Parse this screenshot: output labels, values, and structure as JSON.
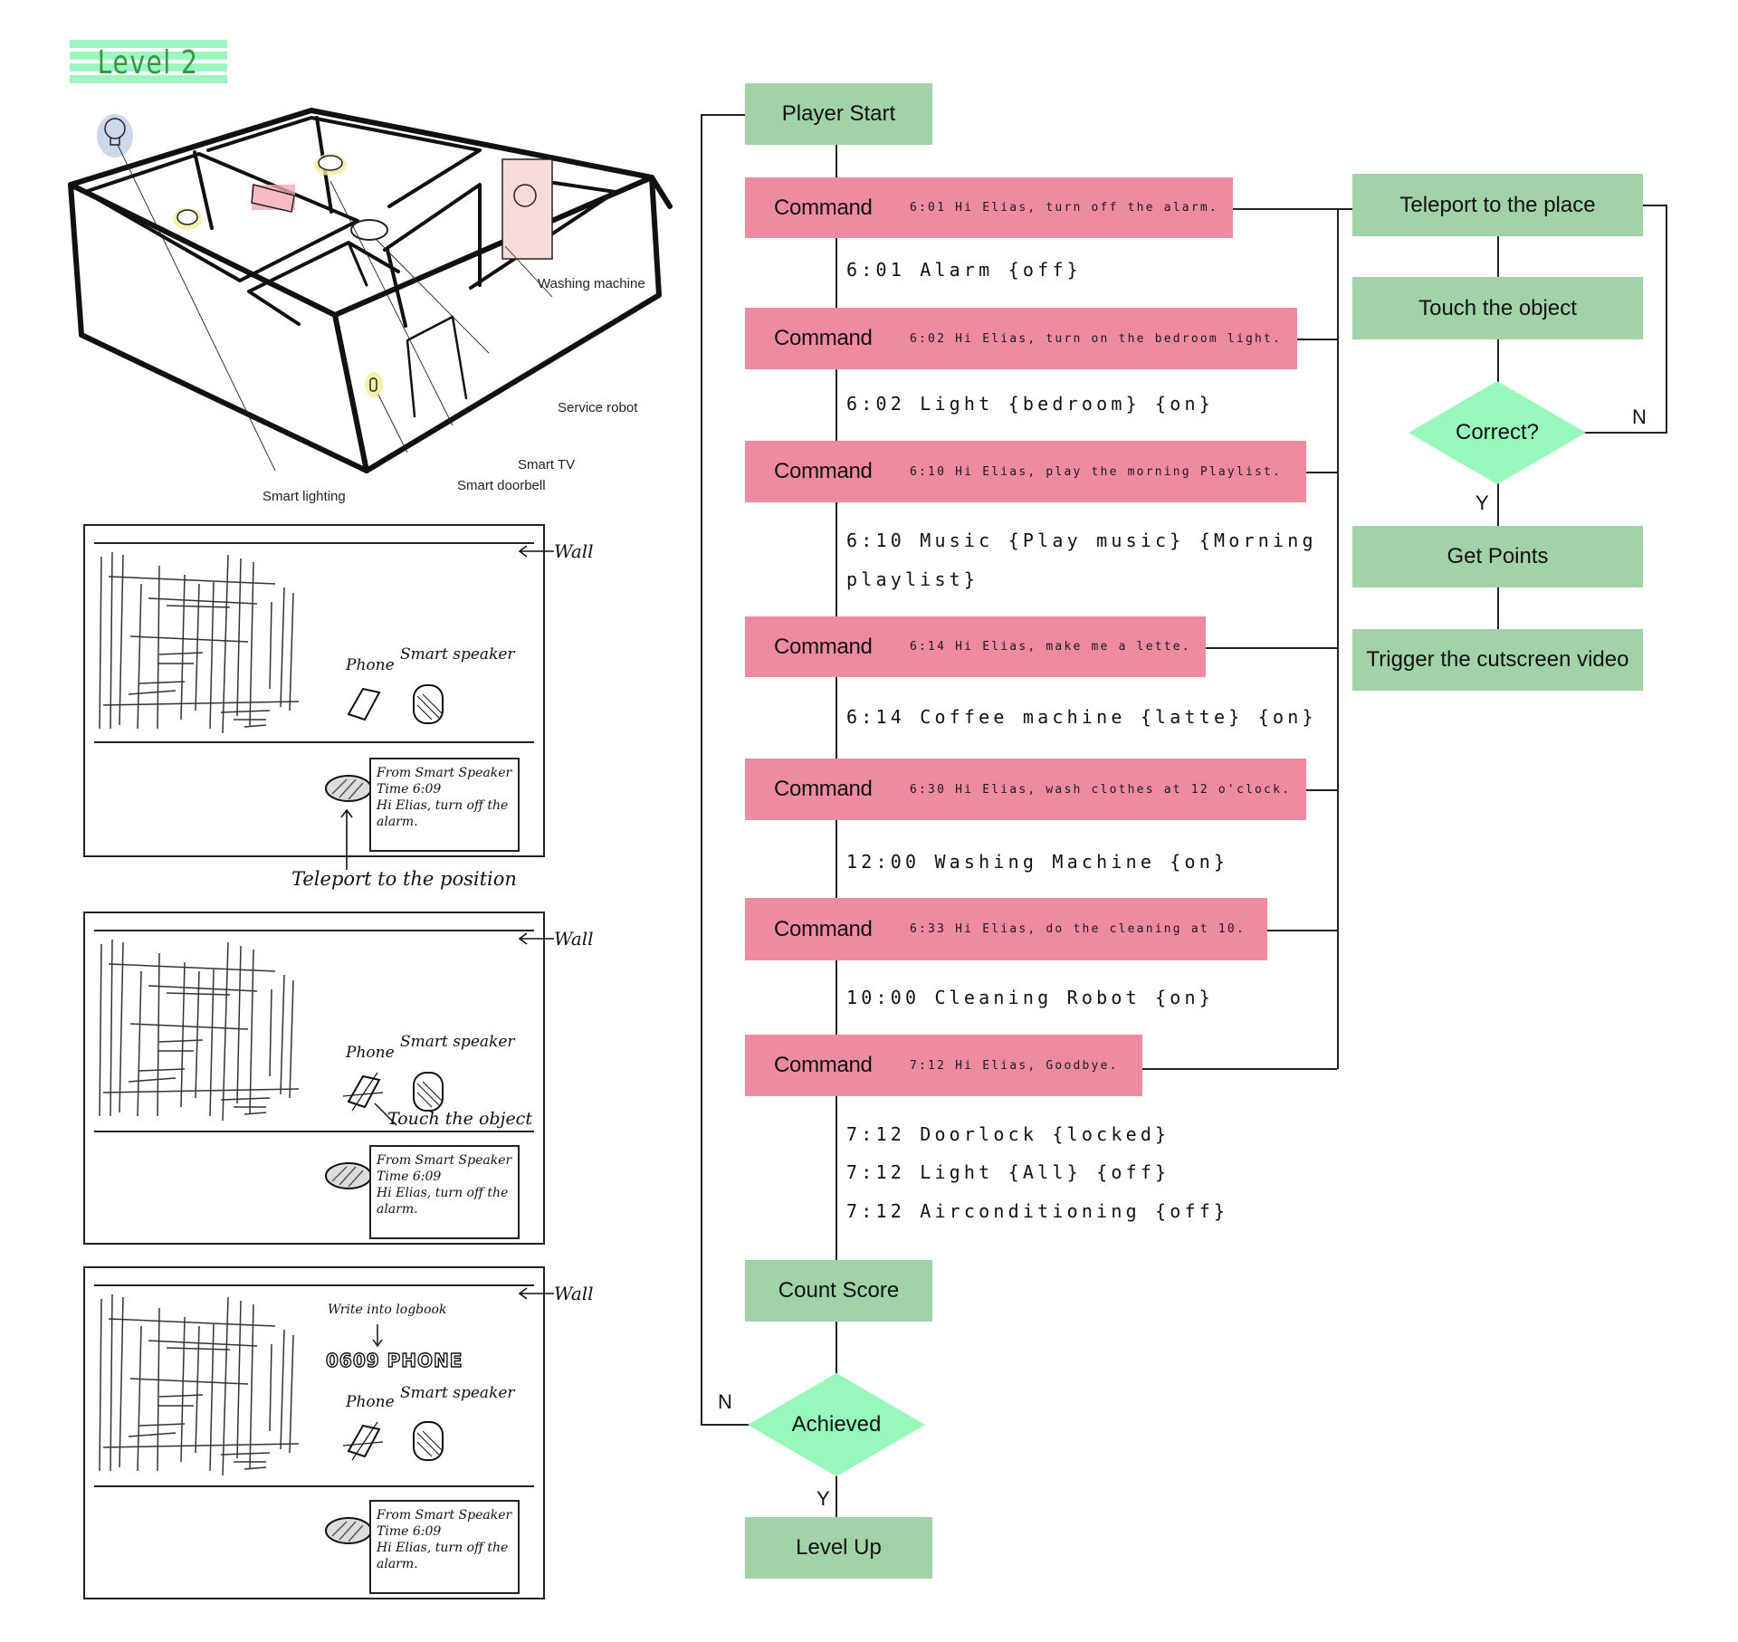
{
  "level_badge": {
    "label": "Level 2",
    "stripe_color": "#9df5c2",
    "text_color": "#2f9a3e"
  },
  "house_diagram": {
    "labels": {
      "washing_machine": "Washing machine",
      "service_robot": "Service robot",
      "smart_tv": "Smart TV",
      "smart_doorbell": "Smart doorbell",
      "smart_lighting": "Smart lighting"
    }
  },
  "sketch_panels": [
    {
      "wall_label": "Wall",
      "phone_label": "Phone",
      "speaker_label": "Smart speaker",
      "message": {
        "from": "From Smart Speaker",
        "time": "Time 6:09",
        "text": "Hi Elias, turn off the alarm."
      },
      "annotation": "Teleport to the position"
    },
    {
      "wall_label": "Wall",
      "phone_label": "Phone",
      "speaker_label": "Smart speaker",
      "message": {
        "from": "From Smart Speaker",
        "time": "Time 6:09",
        "text": "Hi Elias, turn off the alarm."
      },
      "annotation": "Touch the object"
    },
    {
      "wall_label": "Wall",
      "phone_label": "Phone",
      "speaker_label": "Smart speaker",
      "message": {
        "from": "From Smart Speaker",
        "time": "Time 6:09",
        "text": "Hi Elias, turn off the alarm."
      },
      "logbook_label": "Write into logbook",
      "logbook_entry": "0609 PHONE"
    }
  ],
  "flowchart": {
    "colors": {
      "step": "#a2d2a8",
      "command": "#ef8ba0",
      "decision": "#98f8bb",
      "line": "#222222"
    },
    "start": "Player Start",
    "commands": [
      {
        "label": "Command",
        "message": "6:01 Hi Elias, turn off the alarm.",
        "responses": [
          "6:01 Alarm {off}"
        ]
      },
      {
        "label": "Command",
        "message": "6:02 Hi Elias, turn on the bedroom light.",
        "responses": [
          "6:02 Light {bedroom} {on}"
        ]
      },
      {
        "label": "Command",
        "message": "6:10 Hi Elias, play the morning Playlist.",
        "responses": [
          "6:10 Music {Play music} {Morning",
          "playlist}"
        ]
      },
      {
        "label": "Command",
        "message": "6:14 Hi Elias, make me a lette.",
        "responses": [
          "6:14 Coffee machine {latte} {on}"
        ]
      },
      {
        "label": "Command",
        "message": "6:30 Hi Elias, wash clothes at 12 o'clock.",
        "responses": [
          "12:00 Washing Machine {on}"
        ]
      },
      {
        "label": "Command",
        "message": "6:33 Hi Elias, do the cleaning at 10.",
        "responses": [
          "10:00 Cleaning Robot {on}"
        ]
      },
      {
        "label": "Command",
        "message": "7:12 Hi Elias, Goodbye.",
        "responses": [
          "7:12 Doorlock {locked}",
          "7:12 Light {All} {off}",
          "7:12 Airconditioning {off}"
        ]
      }
    ],
    "count_score": "Count Score",
    "achieved": "Achieved",
    "achieved_no": "N",
    "achieved_yes": "Y",
    "level_up": "Level Up",
    "subprocess": {
      "teleport": "Teleport to the place",
      "touch": "Touch the object",
      "correct": "Correct?",
      "correct_no": "N",
      "correct_yes": "Y",
      "get_points": "Get Points",
      "trigger": "Trigger the cutscreen video"
    }
  }
}
